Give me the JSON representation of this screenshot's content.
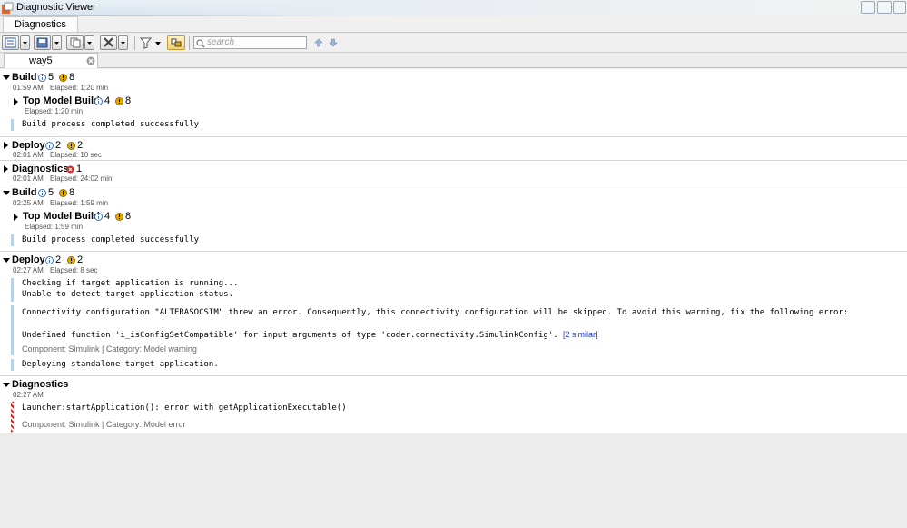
{
  "window": {
    "title": "Diagnostic Viewer"
  },
  "menu": {
    "tab_label": "Diagnostics"
  },
  "toolbar": {
    "search_placeholder": "search"
  },
  "doc_tab": {
    "label": "way5"
  },
  "sections": [
    {
      "title": "Build",
      "info_count": "5",
      "warn_count": "8",
      "time": "01:59 AM",
      "elapsed": "Elapsed: 1:20 min",
      "sub": {
        "title": "Top Model Build",
        "info_count": "4",
        "warn_count": "8",
        "elapsed": "Elapsed: 1:20 min"
      },
      "message": "Build process completed successfully"
    },
    {
      "title": "Deploy",
      "info_count": "2",
      "warn_count": "2",
      "time": "02:01 AM",
      "elapsed": "Elapsed: 10 sec"
    },
    {
      "title": "Diagnostics",
      "error_count": "1",
      "time": "02:01 AM",
      "elapsed": "Elapsed: 24:02 min"
    },
    {
      "title": "Build",
      "info_count": "5",
      "warn_count": "8",
      "time": "02:25 AM",
      "elapsed": "Elapsed: 1:59 min",
      "sub": {
        "title": "Top Model Build",
        "info_count": "4",
        "warn_count": "8",
        "elapsed": "Elapsed: 1:59 min"
      },
      "message": "Build process completed successfully"
    },
    {
      "title": "Deploy",
      "info_count": "2",
      "warn_count": "2",
      "time": "02:27 AM",
      "elapsed": "Elapsed: 8 sec",
      "msg1_line1": "Checking if target application is running...",
      "msg1_line2": "Unable to detect target application status.",
      "warning_line1": "Connectivity configuration \"ALTERASOCSIM\" threw an error. Consequently, this connectivity configuration will be skipped. To avoid this warning, fix the following error:",
      "warning_line2": "Undefined function 'i_isConfigSetCompatible' for input arguments of type 'coder.connectivity.SimulinkConfig'.",
      "similar_link": "[2 similar]",
      "component": "Component:  Simulink | Category:  Model warning",
      "msg3": "Deploying standalone target application."
    },
    {
      "title": "Diagnostics",
      "time": "02:27 AM",
      "error_msg": "Launcher:startApplication(): error with getApplicationExecutable()",
      "component": "Component:  Simulink | Category:  Model error"
    }
  ],
  "colors": {
    "info": "#3f6fb5",
    "warn": "#e0a800",
    "error": "#d42a2a",
    "message_bar": "#b8d2e4"
  }
}
